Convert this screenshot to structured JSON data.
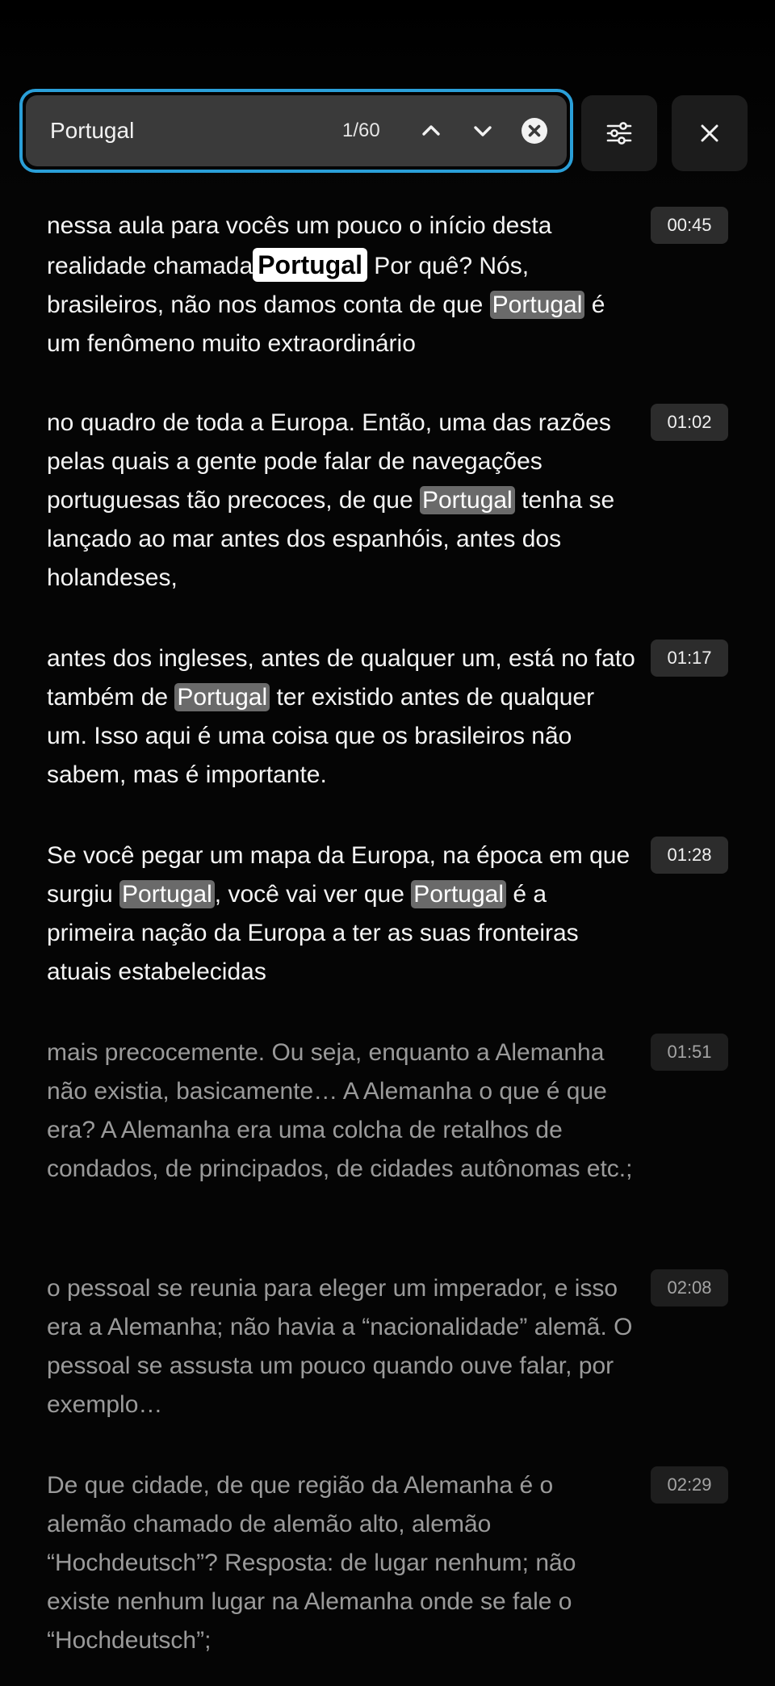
{
  "search": {
    "query": "Portugal",
    "match_counter": "1/60",
    "prev_icon": "chevron-up-icon",
    "next_icon": "chevron-down-icon",
    "clear_icon": "clear-circle-icon"
  },
  "toolbar": {
    "filter_icon": "sliders-icon",
    "close_icon": "close-icon"
  },
  "colors": {
    "focus_ring": "#2a9fd8",
    "match_highlight": "#6a6a6a",
    "current_match": "#ffffff"
  },
  "segments": [
    {
      "time": "00:45",
      "faded": false,
      "parts": [
        {
          "t": "nessa aula para vocês um pouco o início desta realidade chamada"
        },
        {
          "t": "Portugal",
          "hl": "current"
        },
        {
          "t": " Por quê? Nós, brasileiros, não nos damos conta de que "
        },
        {
          "t": "Portugal",
          "hl": "match"
        },
        {
          "t": " é um fenômeno muito extraordinário"
        }
      ]
    },
    {
      "time": "01:02",
      "faded": false,
      "parts": [
        {
          "t": "no quadro de toda a Europa. Então, uma das razões pelas quais a gente pode falar de navegações portuguesas tão precoces, de que "
        },
        {
          "t": "Portugal",
          "hl": "match"
        },
        {
          "t": " tenha se lançado ao mar antes dos espanhóis, antes dos holandeses,"
        }
      ]
    },
    {
      "time": "01:17",
      "faded": false,
      "parts": [
        {
          "t": "antes dos ingleses, antes de qualquer um, está no fato também de "
        },
        {
          "t": "Portugal",
          "hl": "match"
        },
        {
          "t": " ter existido antes de qualquer um. Isso aqui é uma coisa que os brasileiros não sabem, mas é importante."
        }
      ]
    },
    {
      "time": "01:28",
      "faded": false,
      "parts": [
        {
          "t": "Se você pegar um mapa da Europa, na época em que surgiu "
        },
        {
          "t": "Portugal",
          "hl": "match"
        },
        {
          "t": ", você vai ver que "
        },
        {
          "t": "Portugal",
          "hl": "match"
        },
        {
          "t": " é a primeira nação da Europa a ter as suas fronteiras atuais estabelecidas"
        }
      ]
    },
    {
      "time": "01:51",
      "faded": true,
      "parts": [
        {
          "t": "mais precocemente. Ou seja, enquanto a Alemanha não existia, basicamente… A Alemanha o que é que era? A Alemanha era uma colcha de retalhos de condados, de principados, de cidades autônomas etc.;"
        }
      ]
    },
    {
      "time": "02:08",
      "faded": true,
      "parts": [
        {
          "t": "o pessoal se reunia para eleger um imperador, e isso era a Alemanha; não havia a “nacionalidade” alemã. O pessoal se assusta um pouco quando ouve falar, por exemplo…"
        }
      ]
    },
    {
      "time": "02:29",
      "faded": true,
      "parts": [
        {
          "t": "De que cidade, de que região da Alemanha é o alemão chamado de alemão alto, alemão “Hochdeutsch”? Resposta: de lugar nenhum; não existe nenhum lugar na Alemanha onde se fale o “Hochdeutsch”;"
        }
      ]
    }
  ]
}
